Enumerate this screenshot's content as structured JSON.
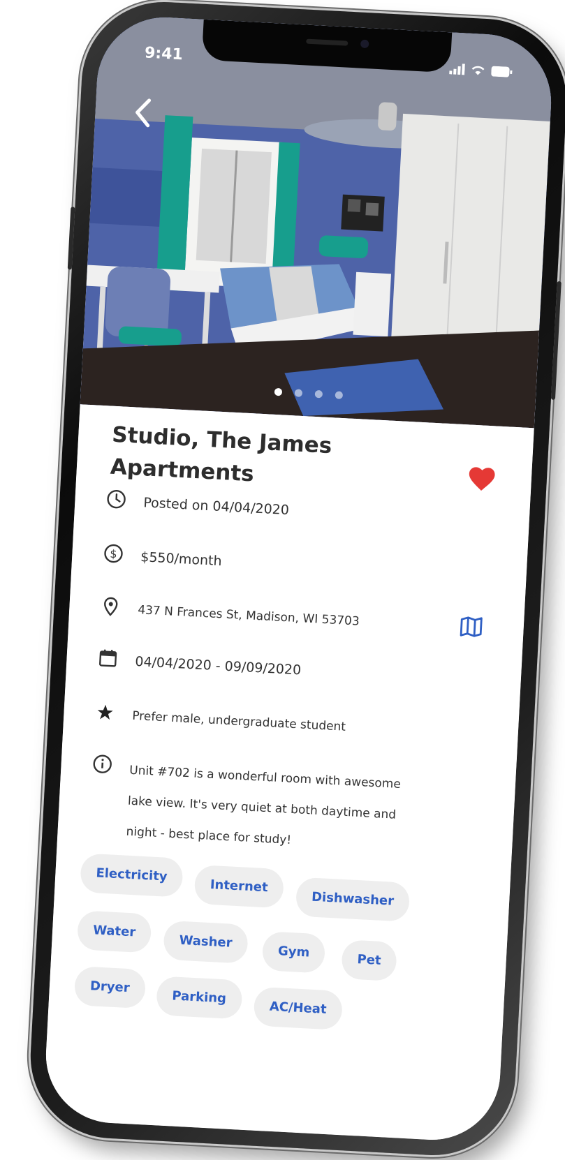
{
  "status_bar": {
    "time": "9:41",
    "signal_icon": "cellular-signal-icon",
    "wifi_icon": "wifi-icon",
    "battery_icon": "battery-icon"
  },
  "gallery": {
    "back_icon": "chevron-left-icon",
    "image_description": "bedroom-photo",
    "page_count": 4,
    "active_page": 1
  },
  "listing": {
    "title_line1": "Studio, The James",
    "title_line2": "Apartments",
    "favorite_icon": "heart-icon",
    "favorite_color": "#e53935",
    "posted": "Posted on 04/04/2020",
    "price": "$550/month",
    "address": "437 N Frances St, Madison, WI 53703",
    "map_icon": "map-icon",
    "dates": "04/04/2020 - 09/09/2020",
    "preference": "Prefer male, undergraduate student",
    "description": [
      "Unit #702 is a wonderful room with awesome",
      "lake view. It's very quiet at both daytime and",
      "night - best place for study!"
    ]
  },
  "amenities": [
    "Electricity",
    "Internet",
    "Dishwasher",
    "Water",
    "Washer",
    "Gym",
    "Pet",
    "Dryer",
    "Parking",
    "AC/Heat"
  ],
  "colors": {
    "accent_blue": "#2f5fc4",
    "tag_bg": "#eeeeee"
  }
}
